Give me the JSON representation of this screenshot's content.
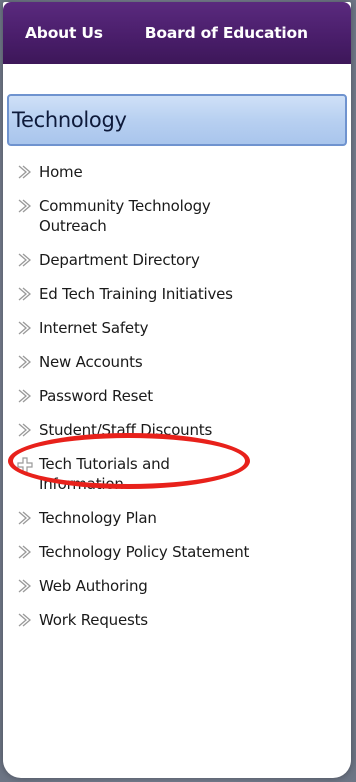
{
  "topnav": {
    "items": [
      "About Us",
      "Board of Education"
    ]
  },
  "section": {
    "title": "Technology"
  },
  "menu": {
    "items": [
      {
        "label": "Home",
        "icon": "chevron-right-icon"
      },
      {
        "label": "Community Technology Outreach",
        "icon": "chevron-right-icon"
      },
      {
        "label": "Department Directory",
        "icon": "chevron-right-icon"
      },
      {
        "label": "Ed Tech Training Initiatives",
        "icon": "chevron-right-icon"
      },
      {
        "label": "Internet Safety",
        "icon": "chevron-right-icon"
      },
      {
        "label": "New Accounts",
        "icon": "chevron-right-icon"
      },
      {
        "label": "Password Reset",
        "icon": "chevron-right-icon"
      },
      {
        "label": "Student/Staff Discounts",
        "icon": "chevron-right-icon"
      },
      {
        "label": "Tech Tutorials and Information",
        "icon": "plus-icon"
      },
      {
        "label": "Technology Plan",
        "icon": "chevron-right-icon"
      },
      {
        "label": "Technology Policy Statement",
        "icon": "chevron-right-icon"
      },
      {
        "label": "Web Authoring",
        "icon": "chevron-right-icon"
      },
      {
        "label": "Work Requests",
        "icon": "chevron-right-icon"
      }
    ]
  },
  "colors": {
    "nav_bg": "#4a1e6b",
    "header_bg": "#b8d0f1",
    "highlight": "#e8211b"
  }
}
